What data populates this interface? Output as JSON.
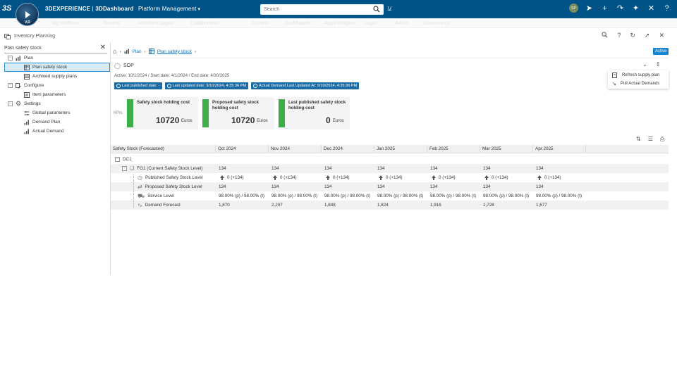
{
  "topbar": {
    "ds_logo": "3S",
    "compass_version": "V,R",
    "brand_bold": "3DEXPERIENCE",
    "brand_sep": " | ",
    "brand_light": "3DDashboard",
    "app_name": "Platform Management",
    "search_placeholder": "Search",
    "avatar": "SP"
  },
  "ghost_tabs": [
    "My Platform",
    "Tenants",
    "Members pages",
    "Collaborative",
    "Content",
    "Dashboards",
    "Apps/Widgets",
    "Login",
    "Admin",
    "Governance"
  ],
  "widget": {
    "title": "Inventory Planning"
  },
  "left_panel": {
    "filter_value": "Plan safety stock",
    "tree": [
      {
        "label": "Plan",
        "toggle": "-",
        "level": 0
      },
      {
        "label": "Plan safety stock",
        "level": 1,
        "selected": true
      },
      {
        "label": "Archived supply plans",
        "level": 1
      },
      {
        "label": "Configure",
        "toggle": "-",
        "level": 0
      },
      {
        "label": "Item parameters",
        "level": 1
      },
      {
        "label": "Settings",
        "toggle": "-",
        "level": 0
      },
      {
        "label": "Global parameters",
        "level": 1
      },
      {
        "label": "Demand Plan",
        "level": 1
      },
      {
        "label": "Actual Demand",
        "level": 1
      }
    ]
  },
  "breadcrumb": {
    "plan": "Plan",
    "current": "Plan safety stock"
  },
  "status": "Active",
  "scenario": {
    "name": "SOP",
    "meta": "Active: 10/1/2024 / Start date: 4/1/2024 / End date: 4/30/2025"
  },
  "menu": {
    "refresh": "Refresh supply plan",
    "pull": "Pull Actual Demands"
  },
  "pills": [
    "Last published date: -",
    "Last updated date: 9/10/2024, 4:35:36 PM",
    "Actual Demand Last Updated At: 9/10/2024, 4:35:36 PM"
  ],
  "kpis": {
    "label": "KPIs",
    "cards": [
      {
        "title": "Safety stock holding cost",
        "value": "10720",
        "unit": "Euros"
      },
      {
        "title": "Proposed safety stock holding cost",
        "value": "10720",
        "unit": "Euros"
      },
      {
        "title": "Last published safety stock holding cost",
        "value": "0",
        "unit": "Euros"
      }
    ]
  },
  "table": {
    "headers": [
      "Safety Stock (Forecasted)",
      "Oct 2024",
      "Nov 2024",
      "Dec 2024",
      "Jan 2025",
      "Feb 2025",
      "Mar 2025",
      "Apr 2025"
    ],
    "group": {
      "toggle": "-",
      "label": "DC1"
    },
    "item": {
      "toggle": "-",
      "label": "FG1 (Current Safety Stock Level)",
      "values": [
        "134",
        "134",
        "134",
        "134",
        "134",
        "134",
        "134"
      ]
    },
    "rows": [
      {
        "label": "Published Safety Stock Level",
        "values": [
          "0 (+134)",
          "0 (+134)",
          "0 (+134)",
          "0 (+134)",
          "0 (+134)",
          "0 (+134)",
          "0 (+134)"
        ],
        "arrow": true
      },
      {
        "label": "Proposed Safety Stock Level",
        "values": [
          "134",
          "134",
          "134",
          "134",
          "134",
          "134",
          "134"
        ]
      },
      {
        "label": "Service Level",
        "values": [
          "98.00% (p) / 98.00% (t)",
          "98.00% (p) / 98.00% (t)",
          "98.00% (p) / 98.00% (t)",
          "98.00% (p) / 98.00% (t)",
          "98.00% (p) / 98.00% (t)",
          "98.00% (p) / 98.00% (t)",
          "98.00% (p) / 98.00% (t)"
        ]
      },
      {
        "label": "Demand Forecast",
        "values": [
          "1,870",
          "2,207",
          "1,848",
          "1,824",
          "1,916",
          "1,728",
          "1,677"
        ]
      }
    ]
  }
}
